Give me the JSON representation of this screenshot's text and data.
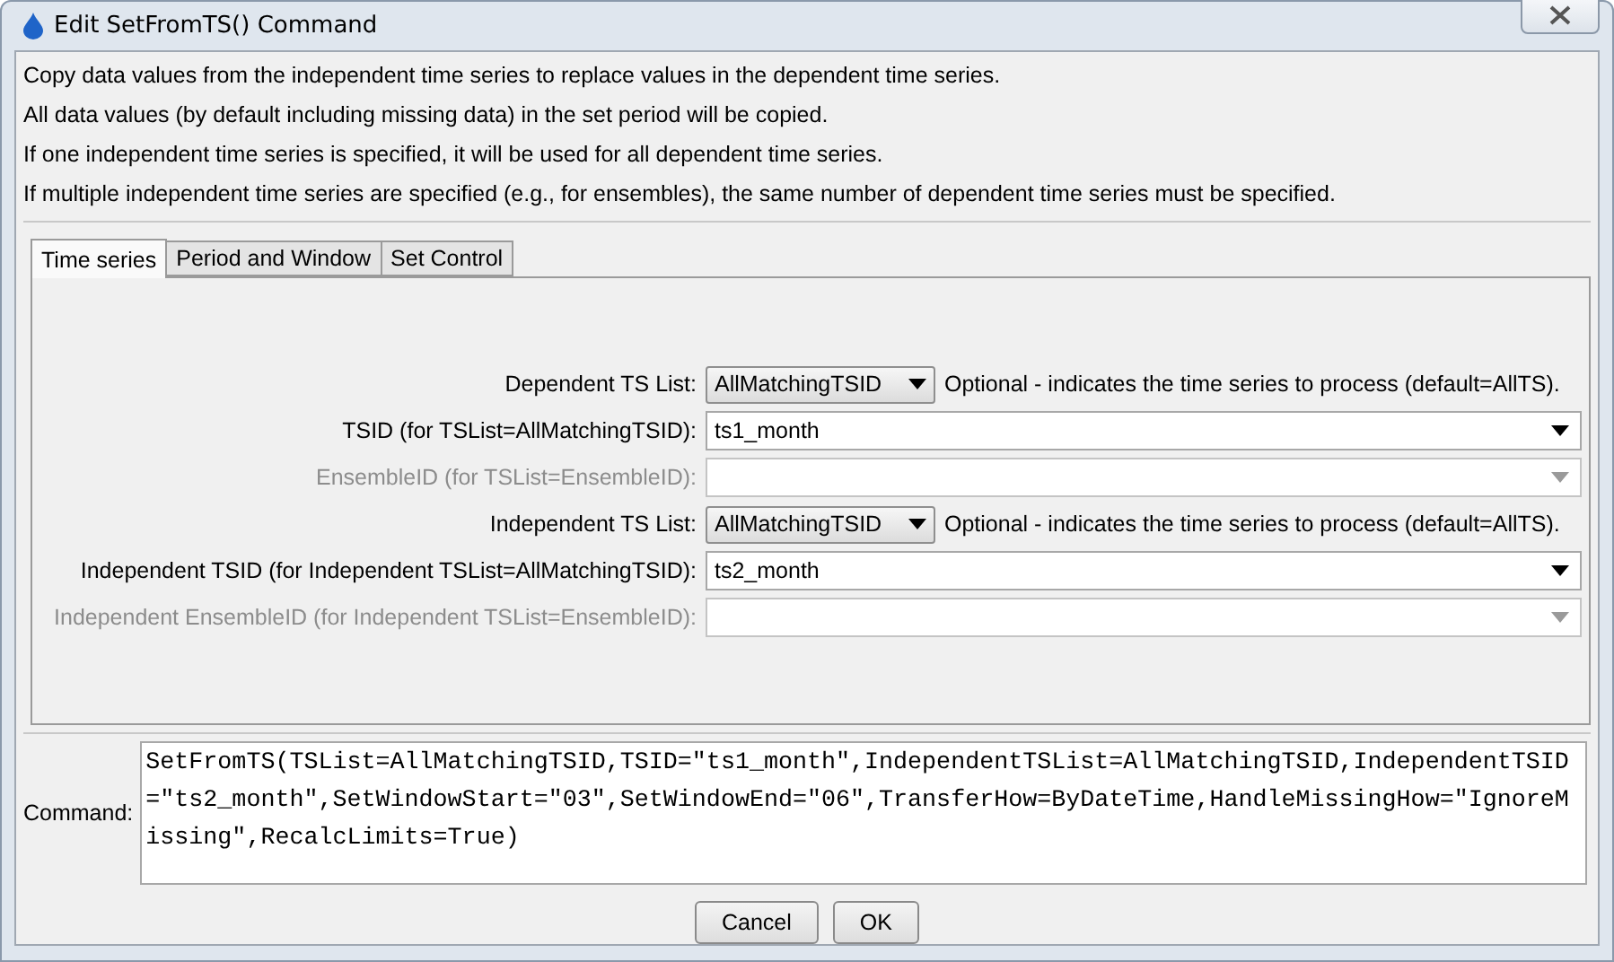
{
  "window": {
    "title": "Edit SetFromTS() Command"
  },
  "description": [
    "Copy data values from the independent time series to replace values in the dependent time series.",
    "All data values (by default including missing data) in the set period will be copied.",
    "If one independent time series is specified, it will be used for all dependent time series.",
    "If multiple independent time series are specified (e.g., for ensembles), the same number of dependent time series must be specified."
  ],
  "tabs": [
    {
      "label": "Time series",
      "selected": true
    },
    {
      "label": "Period and Window",
      "selected": false
    },
    {
      "label": "Set Control",
      "selected": false
    }
  ],
  "rows": [
    {
      "kind": "choice",
      "label": "Dependent TS List:",
      "value": "AllMatchingTSID",
      "note": "Optional - indicates the time series to process (default=AllTS).",
      "disabled": false
    },
    {
      "kind": "combo",
      "label": "TSID (for TSList=AllMatchingTSID):",
      "value": "ts1_month",
      "disabled": false
    },
    {
      "kind": "combo",
      "label": "EnsembleID (for TSList=EnsembleID):",
      "disabled": true
    },
    {
      "kind": "choice",
      "label": "Independent TS List:",
      "value": "AllMatchingTSID",
      "note": "Optional - indicates the time series to process (default=AllTS).",
      "disabled": false
    },
    {
      "kind": "combo",
      "label": "Independent TSID (for Independent TSList=AllMatchingTSID):",
      "value": "ts2_month",
      "disabled": false
    },
    {
      "kind": "combo",
      "label": "Independent EnsembleID (for Independent TSList=EnsembleID):",
      "disabled": true
    }
  ],
  "command": {
    "label": "Command:",
    "value": "SetFromTS(TSList=AllMatchingTSID,TSID=\"ts1_month\",IndependentTSList=AllMatchingTSID,IndependentTSID=\"ts2_month\",SetWindowStart=\"03\",SetWindowEnd=\"06\",TransferHow=ByDateTime,HandleMissingHow=\"IgnoreMissing\",RecalcLimits=True)"
  },
  "buttons": [
    "Cancel",
    "OK"
  ]
}
